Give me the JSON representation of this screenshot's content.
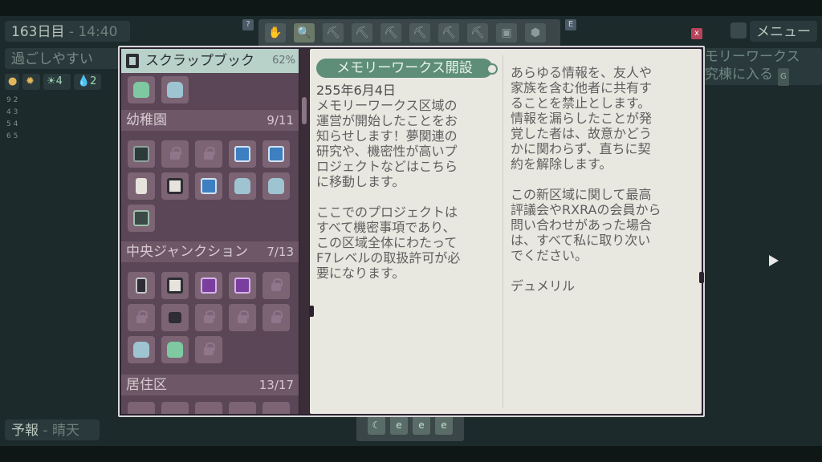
{
  "hud": {
    "day": "163日目",
    "time": "14:40",
    "mood": "過ごしやすい",
    "stats": [
      "☀4",
      "💧2"
    ],
    "mini_rows": [
      "9  2",
      "4  3",
      "5  4",
      "6  5"
    ],
    "menu_label": "メニュー",
    "close_label": "x",
    "q_label": "?",
    "e_label": "E",
    "forecast_label": "予報",
    "forecast_value": "晴天",
    "bg_memory_line1": "モリーワークス",
    "bg_memory_line2": "究棟に入る",
    "bg_memory_key": "G"
  },
  "toolbar": {
    "tools": [
      "✋",
      "🔍",
      "⛏",
      "⛏",
      "⛏",
      "⛏",
      "⛏",
      "⛏",
      "▣",
      "⬢"
    ]
  },
  "bottom_bar": {
    "slots": [
      "☾",
      "e",
      "e",
      "e"
    ]
  },
  "scrapbook": {
    "title": "スクラップブック",
    "percent": "62%",
    "sections": [
      {
        "name": "幼稚園",
        "count": "9/11"
      },
      {
        "name": "中央ジャンクション",
        "count": "7/13"
      },
      {
        "name": "居住区",
        "count": "13/17"
      }
    ]
  },
  "letter": {
    "title": "メモリーワークス開設",
    "date": "255年6月4日",
    "left_body": "メモリーワークス区域の\n運営が開始したことをお\n知らせします！夢関連の\n研究や、機密性が高いプ\nロジェクトなどはこちら\nに移動します。\n\nここでのプロジェクトは\nすべて機密事項であり、\nこの区域全体にわたって\nF7レベルの取扱許可が必\n要になります。",
    "right_body": "あらゆる情報を、友人や\n家族を含む他者に共有す\nることを禁止とします。\n情報を漏らしたことが発\n覚した者は、故意かどう\nかに関わらず、直ちに契\n約を解除します。\n\nこの新区域に関して最高\n評議会やRXRAの会員から\n問い合わせがあった場合\nは、すべて私に取り次い\nでください。\n\nデュメリル"
  }
}
